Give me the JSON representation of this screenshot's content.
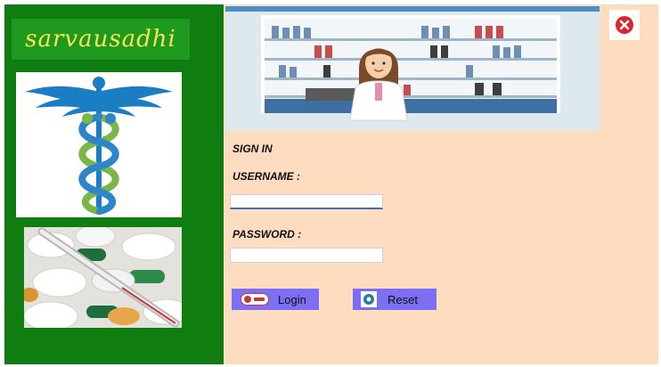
{
  "sidebar": {
    "brand_title": "sarvausadhi"
  },
  "form": {
    "heading": "SIGN IN",
    "username_label": "USERNAME :",
    "username_value": "",
    "password_label": "PASSWORD :",
    "password_value": ""
  },
  "buttons": {
    "login_label": "Login",
    "reset_label": "Reset"
  },
  "icons": {
    "close": "close-icon",
    "login": "login-badge-icon",
    "reset": "reset-icon",
    "logo": "caduceus-icon"
  },
  "colors": {
    "sidebar": "#0f7d0f",
    "brand_bg": "#1f9a1f",
    "brand_text": "#f4e55a",
    "main_bg": "#fddcbf",
    "button_bg": "#7c6ff5",
    "close_red": "#d9262c"
  }
}
